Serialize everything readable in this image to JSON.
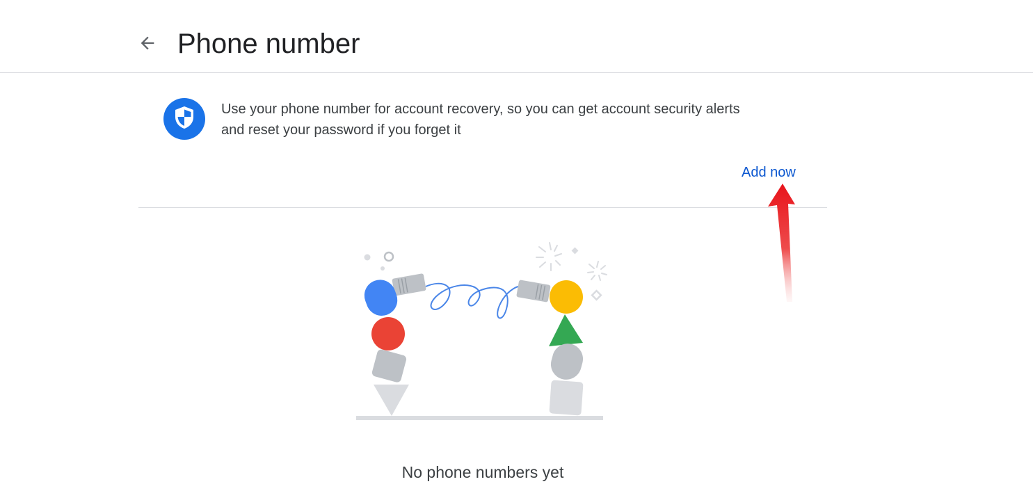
{
  "header": {
    "back_icon": "arrow-back-icon",
    "title": "Phone number"
  },
  "info": {
    "icon": "shield-icon",
    "text_line1": "Use your phone number for account recovery, so you can get account security alerts",
    "text_line2": "and reset your password if you forget it",
    "action_label": "Add now"
  },
  "empty_state": {
    "illustration": "no-phone-illustration",
    "message": "No phone numbers yet"
  },
  "colors": {
    "accent": "#1a73e8",
    "link": "#0b57d0",
    "annotation": "#e8141b",
    "blue": "#4285f4",
    "red": "#ea4335",
    "yellow": "#fbbc04",
    "green": "#34a853",
    "gray": "#bdc1c6"
  }
}
